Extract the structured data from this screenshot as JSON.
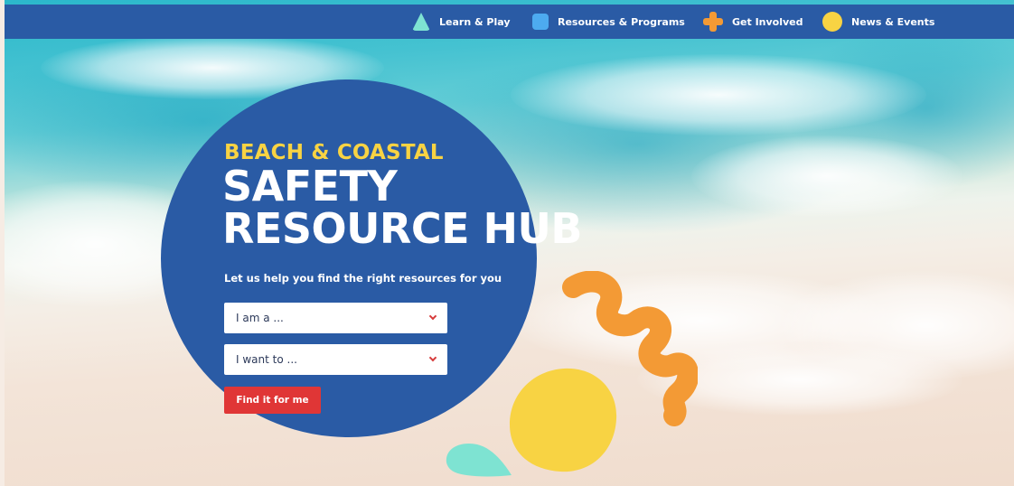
{
  "nav": {
    "items": [
      {
        "label": "Learn & Play",
        "icon": "triangle-icon",
        "color": "#7ee3d2"
      },
      {
        "label": "Resources & Programs",
        "icon": "square-icon",
        "color": "#4dabf0"
      },
      {
        "label": "Get Involved",
        "icon": "plus-icon",
        "color": "#f39a35"
      },
      {
        "label": "News & Events",
        "icon": "circle-icon",
        "color": "#f8d343"
      }
    ]
  },
  "hero": {
    "eyebrow": "BEACH & COASTAL",
    "title_line1": "SAFETY",
    "title_line2": "RESOURCE HUB",
    "helper": "Let us help you find the right resources for you",
    "select_role": {
      "value": "I am a ..."
    },
    "select_goal": {
      "value": "I want to ..."
    },
    "cta_label": "Find it for me"
  },
  "colors": {
    "brand_blue": "#2a5ba5",
    "accent_yellow": "#f8d343",
    "accent_red": "#e03636",
    "accent_orange": "#f39a35",
    "accent_teal": "#7ee3d2"
  }
}
